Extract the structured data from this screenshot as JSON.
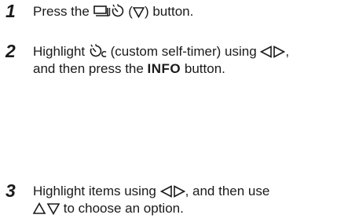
{
  "steps": [
    {
      "number": "1",
      "text_before_icons": "Press the ",
      "icons": [
        "drive-mode-icon",
        "self-timer-icon"
      ],
      "paren_open": " (",
      "paren_icon": "down-triangle-icon",
      "paren_close": ")",
      "text_after": " button."
    },
    {
      "number": "2",
      "line1_before": "Highlight ",
      "line1_icon": "custom-self-timer-icon",
      "line1_mid": " (custom self-timer) using ",
      "line1_icon2": "left-right-arrows-icon",
      "line1_end": ",",
      "line2_before": "and then press the ",
      "line2_bold": "INFO",
      "line2_after": " button."
    },
    {
      "number": "3",
      "line1_before": "Highlight items using ",
      "line1_icon": "left-right-arrows-icon",
      "line1_after": ", and then use",
      "line2_icon": "up-down-arrows-icon",
      "line2_after": " to choose an option."
    }
  ]
}
